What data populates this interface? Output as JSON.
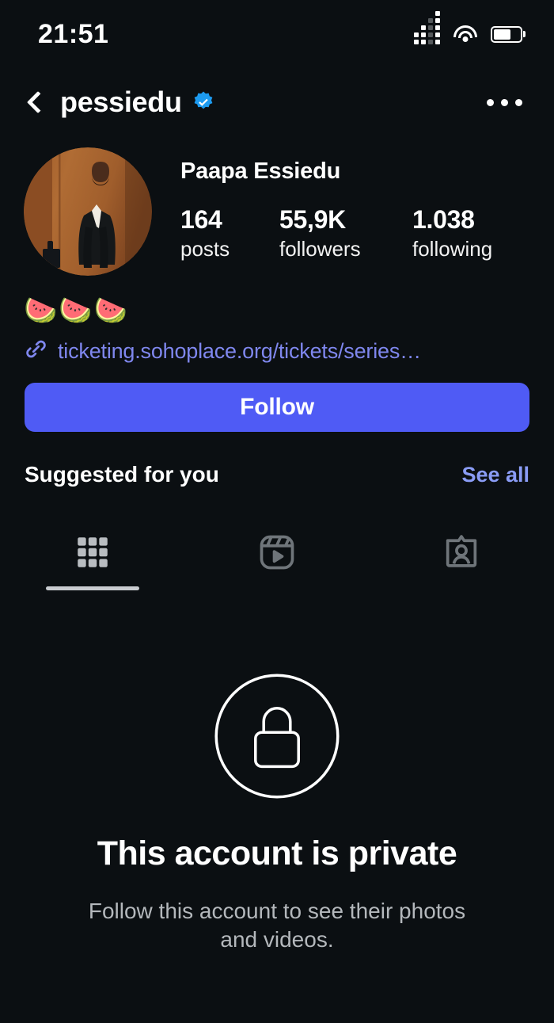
{
  "statusbar": {
    "time": "21:51",
    "signal_icon": "cellular-signal-icon",
    "wifi_icon": "wifi-icon",
    "battery_icon": "battery-icon",
    "battery_level": 65
  },
  "header": {
    "back_icon": "back-chevron-icon",
    "username": "pessiedu",
    "verified_icon": "verified-badge-icon",
    "menu_icon": "more-options-icon"
  },
  "profile": {
    "avatar_icon": "profile-avatar",
    "full_name": "Paapa Essiedu",
    "stats": [
      {
        "value": "164",
        "label": "posts"
      },
      {
        "value": "55,9K",
        "label": "followers"
      },
      {
        "value": "1.038",
        "label": "following"
      }
    ]
  },
  "bio": {
    "emoji_line": "🍉🍉🍉",
    "link_icon": "link-chain-icon",
    "link_text": "ticketing.sohoplace.org/tickets/series…"
  },
  "actions": {
    "follow_label": "Follow"
  },
  "suggested": {
    "title": "Suggested for you",
    "see_all_label": "See all"
  },
  "tabs": [
    {
      "name": "grid",
      "icon": "grid-icon",
      "active": true
    },
    {
      "name": "reels",
      "icon": "reels-icon",
      "active": false
    },
    {
      "name": "tagged",
      "icon": "tagged-icon",
      "active": false
    }
  ],
  "private_notice": {
    "lock_icon": "lock-icon",
    "title": "This account is private",
    "subtitle": "Follow this account to see their photos and videos."
  },
  "colors": {
    "background": "#0b0f12",
    "follow_button": "#4f5bf5",
    "link_blue": "#7f87ee",
    "see_all_blue": "#8a9cf5",
    "verified_blue": "#1d9bf0",
    "tab_active": "#d2d5d9",
    "tab_inactive": "#6f757a",
    "secondary_text": "#b4b8bc"
  }
}
